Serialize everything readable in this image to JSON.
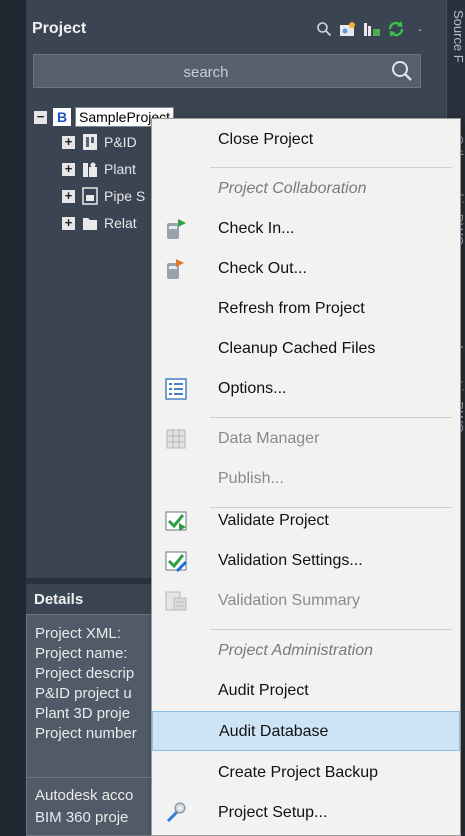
{
  "panel": {
    "title": "Project",
    "header_icons": [
      "search-icon",
      "project-photo-icon",
      "manager-icon",
      "refresh-icon",
      "more-icon"
    ],
    "more_glyph": "·",
    "search": {
      "placeholder": "search"
    },
    "right_tabs": [
      "Source F",
      "Orthographic DWG",
      "Isometric DWG"
    ]
  },
  "tree": {
    "root": {
      "badge": "B",
      "label": "SampleProject"
    },
    "children": [
      {
        "label": "P&ID",
        "icon": "pid-icon"
      },
      {
        "label": "Plant",
        "icon": "plant-icon"
      },
      {
        "label": "Pipe S",
        "icon": "pipe-spec-icon"
      },
      {
        "label": "Relat",
        "icon": "related-files-icon"
      }
    ],
    "expander_glyph": "+",
    "root_expander_glyph": "−"
  },
  "details": {
    "title": "Details",
    "rows": [
      "Project XML:",
      "Project name:",
      "Project descrip",
      "P&ID project u",
      "Plant 3D proje",
      "Project number"
    ],
    "rows_after": [
      "Autodesk acco",
      "BIM 360 proje"
    ]
  },
  "context_menu": {
    "items": [
      {
        "label": "Close Project",
        "state": "normal",
        "icon": ""
      },
      {
        "label": "Project Collaboration",
        "state": "header",
        "icon": ""
      },
      {
        "label": "Check In...",
        "state": "normal",
        "icon": "check-in-icon"
      },
      {
        "label": "Check Out...",
        "state": "normal",
        "icon": "check-out-icon"
      },
      {
        "label": "Refresh from Project",
        "state": "normal",
        "icon": ""
      },
      {
        "label": "Cleanup Cached Files",
        "state": "normal",
        "icon": ""
      },
      {
        "label": "Options...",
        "state": "normal",
        "icon": "options-icon"
      },
      {
        "label": "Data Manager",
        "state": "disabled",
        "icon": "data-manager-icon"
      },
      {
        "label": "Publish...",
        "state": "disabled",
        "icon": ""
      },
      {
        "label": "Validate Project",
        "state": "normal",
        "icon": "validate-project-icon"
      },
      {
        "label": "Validation Settings...",
        "state": "normal",
        "icon": "validation-settings-icon"
      },
      {
        "label": "Validation Summary",
        "state": "disabled",
        "icon": "validation-summary-icon"
      },
      {
        "label": "Project Administration",
        "state": "header",
        "icon": ""
      },
      {
        "label": "Audit Project",
        "state": "normal",
        "icon": ""
      },
      {
        "label": "Audit Database",
        "state": "highlighted",
        "icon": ""
      },
      {
        "label": "Create Project Backup",
        "state": "normal",
        "icon": ""
      },
      {
        "label": "Project Setup...",
        "state": "normal",
        "icon": "project-setup-icon"
      }
    ]
  },
  "colors": {
    "panel_bg": "#3b4453",
    "menu_bg": "#f2f2f2",
    "menu_highlight": "#cde4f7",
    "accent_green": "#2ea043",
    "accent_blue": "#1c6fd1"
  }
}
